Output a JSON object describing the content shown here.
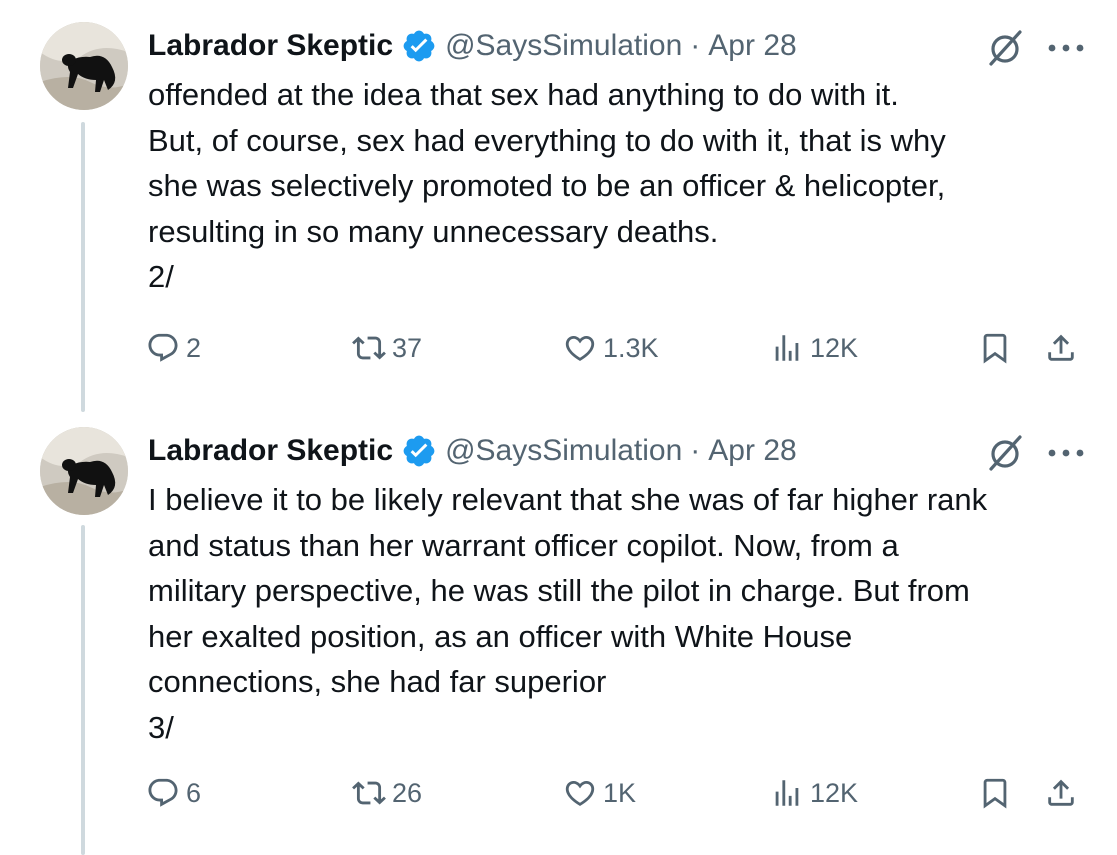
{
  "tweets": [
    {
      "author_name": "Labrador Skeptic",
      "handle": "@SaysSimulation",
      "separator": "·",
      "date": "Apr 28",
      "text_lines": [
        "offended at the idea that sex had anything to do with it.",
        "But, of course, sex had everything to do with it, that is why",
        "she was selectively promoted to be an officer & helicopter,",
        "resulting in so many unnecessary deaths.",
        "2/"
      ],
      "replies": "2",
      "reposts": "37",
      "likes": "1.3K",
      "views": "12K"
    },
    {
      "author_name": "Labrador Skeptic",
      "handle": "@SaysSimulation",
      "separator": "·",
      "date": "Apr 28",
      "text_lines": [
        "I believe it to be likely relevant that she was of far higher rank",
        "and status than her warrant officer copilot. Now, from a",
        "military perspective, he was still the pilot in charge. But from",
        "her exalted position, as an officer with White House",
        "connections, she had far superior",
        "3/"
      ],
      "replies": "6",
      "reposts": "26",
      "likes": "1K",
      "views": "12K"
    }
  ],
  "icons": {
    "verified": "verified-badge-icon",
    "grok": "grok-icon",
    "more": "more-icon",
    "reply": "reply-icon",
    "repost": "repost-icon",
    "like": "heart-icon",
    "views": "views-icon",
    "bookmark": "bookmark-icon",
    "share": "share-icon"
  },
  "colors": {
    "verified": "#1d9bf0",
    "text": "#0f1419",
    "secondary": "#536471",
    "thread_line": "#cfd9de"
  }
}
